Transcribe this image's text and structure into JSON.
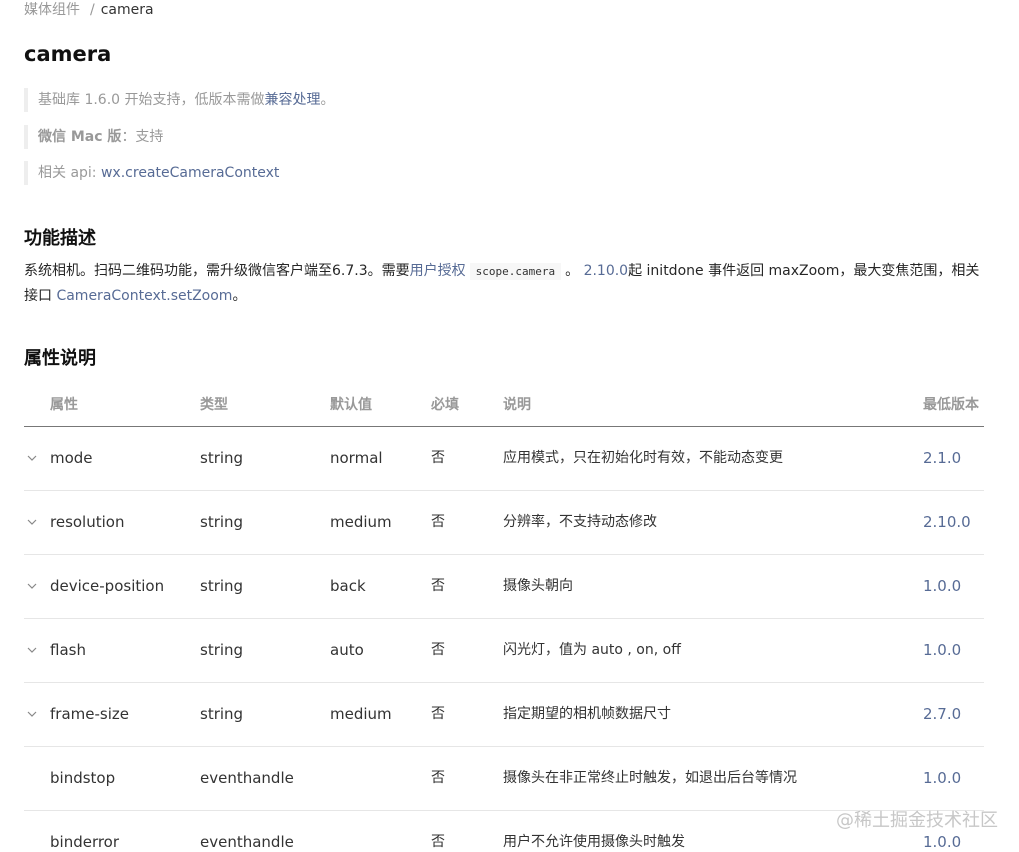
{
  "breadcrumb": {
    "parent": "媒体组件",
    "separator": "/",
    "current": "camera"
  },
  "page_title": "camera",
  "notes": {
    "base_lib_prefix": "基础库 1.6.0 开始支持，低版本需做",
    "base_lib_link": "兼容处理",
    "base_lib_suffix": "。",
    "mac_label": "微信 Mac 版",
    "mac_value": "：支持",
    "api_label": "相关 api: ",
    "api_link": "wx.createCameraContext"
  },
  "section_desc": {
    "title": "功能描述",
    "text_1": "系统相机。扫码二维码功能，需升级微信客户端至6.7.3。需要",
    "link_auth": "用户授权",
    "code_scope": "scope.camera",
    "text_2": "。",
    "link_version": "2.10.0",
    "text_3": "起 initdone 事件返回 maxZoom，最大变焦范围，相关接口 ",
    "link_zoom": "CameraContext.setZoom",
    "text_4": "。"
  },
  "section_attrs": {
    "title": "属性说明"
  },
  "table": {
    "headers": {
      "name": "属性",
      "type": "类型",
      "default": "默认值",
      "required": "必填",
      "desc": "说明",
      "version": "最低版本"
    },
    "rows": [
      {
        "expandable": true,
        "name": "mode",
        "type": "string",
        "default": "normal",
        "required": "否",
        "desc": "应用模式，只在初始化时有效，不能动态变更",
        "version": "2.1.0"
      },
      {
        "expandable": true,
        "name": "resolution",
        "type": "string",
        "default": "medium",
        "required": "否",
        "desc": "分辨率，不支持动态修改",
        "version": "2.10.0"
      },
      {
        "expandable": true,
        "name": "device-position",
        "type": "string",
        "default": "back",
        "required": "否",
        "desc": "摄像头朝向",
        "version": "1.0.0"
      },
      {
        "expandable": true,
        "name": "flash",
        "type": "string",
        "default": "auto",
        "required": "否",
        "desc": "闪光灯，值为 auto , on, off",
        "version": "1.0.0"
      },
      {
        "expandable": true,
        "name": "frame-size",
        "type": "string",
        "default": "medium",
        "required": "否",
        "desc": "指定期望的相机帧数据尺寸",
        "version": "2.7.0"
      },
      {
        "expandable": false,
        "name": "bindstop",
        "type": "eventhandle",
        "default": "",
        "required": "否",
        "desc": "摄像头在非正常终止时触发，如退出后台等情况",
        "version": "1.0.0"
      },
      {
        "expandable": false,
        "name": "binderror",
        "type": "eventhandle",
        "default": "",
        "required": "否",
        "desc": "用户不允许使用摄像头时触发",
        "version": "1.0.0"
      }
    ]
  },
  "watermark": "@稀土掘金技术社区"
}
